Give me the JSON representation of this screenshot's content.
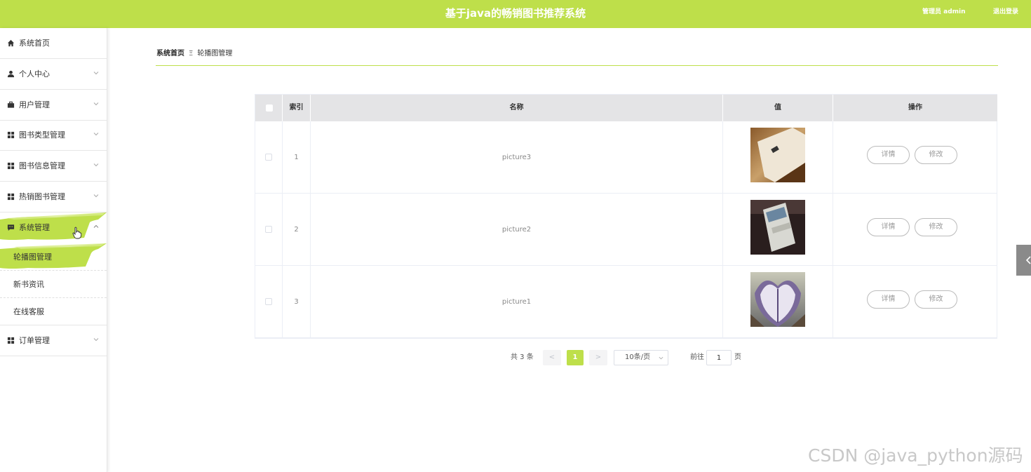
{
  "header": {
    "title": "基于java的畅销图书推荐系统",
    "admin_label": "管理员 admin",
    "logout_label": "退出登录",
    "brand_color": "#bedf4a"
  },
  "sidebar": {
    "items": [
      {
        "label": "系统首页",
        "icon": "home-icon"
      },
      {
        "label": "个人中心",
        "icon": "user-icon"
      },
      {
        "label": "用户管理",
        "icon": "briefcase-icon"
      },
      {
        "label": "图书类型管理",
        "icon": "grid-icon"
      },
      {
        "label": "图书信息管理",
        "icon": "grid-icon"
      },
      {
        "label": "热销图书管理",
        "icon": "grid-icon"
      },
      {
        "label": "系统管理",
        "icon": "message-icon"
      },
      {
        "label": "订单管理",
        "icon": "grid-icon"
      }
    ],
    "sub_items": [
      {
        "label": "轮播图管理"
      },
      {
        "label": "新书资讯"
      },
      {
        "label": "在线客服"
      }
    ]
  },
  "breadcrumb": {
    "home": "系统首页",
    "separator": "Ξ",
    "current": "轮播图管理"
  },
  "table": {
    "headers": {
      "index": "索引",
      "name": "名称",
      "value": "值",
      "actions": "操作"
    },
    "rows": [
      {
        "index": "1",
        "name": "picture3",
        "detail": "详情",
        "edit": "修改"
      },
      {
        "index": "2",
        "name": "picture2",
        "detail": "详情",
        "edit": "修改"
      },
      {
        "index": "3",
        "name": "picture1",
        "detail": "详情",
        "edit": "修改"
      }
    ]
  },
  "pagination": {
    "total": "共 3 条",
    "prev": "<",
    "current": "1",
    "next": ">",
    "page_size": "10条/页",
    "goto": "前往",
    "goto_value": "1",
    "page_suffix": "页"
  },
  "watermark": "CSDN @java_python源码"
}
